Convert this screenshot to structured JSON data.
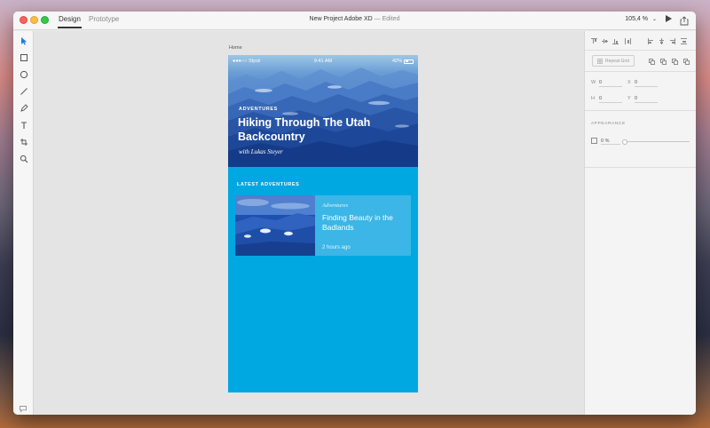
{
  "window": {
    "tabs": [
      {
        "label": "Design",
        "active": true
      },
      {
        "label": "Prototype",
        "active": false
      }
    ],
    "title": "New Project Adobe XD",
    "title_suffix": "— Edited",
    "zoom": "105,4 %"
  },
  "toolbar": {
    "tools": [
      "select-icon",
      "rectangle-icon",
      "ellipse-icon",
      "line-icon",
      "pen-icon",
      "text-icon",
      "artboard-icon",
      "zoom-icon"
    ]
  },
  "artboard": {
    "label": "Home",
    "status_bar": {
      "carrier": "●●●○○ Slyck",
      "time": "9:41 AM",
      "battery": "42%"
    },
    "hero": {
      "eyebrow": "ADVENTURES",
      "title": "Hiking  Through The Utah Backcountry",
      "byline": "with Lukas Steyer"
    },
    "section_heading": "LATEST ADVENTURES",
    "card": {
      "category": "Adventures",
      "title": "Finding Beauty in the Badlands",
      "time": "2 hours ago"
    },
    "colors": {
      "background": "#00a8e2",
      "card": "#3bb6e6",
      "hero_dark": "#163f8f"
    }
  },
  "properties": {
    "repeat_grid": "Repeat Grid",
    "w_label": "W",
    "w_value": "0",
    "h_label": "H",
    "h_value": "0",
    "x_label": "X",
    "x_value": "0",
    "y_label": "Y",
    "y_value": "0",
    "appearance_title": "APPEARANCE",
    "opacity": "0 %",
    "opacity_level": 0
  }
}
